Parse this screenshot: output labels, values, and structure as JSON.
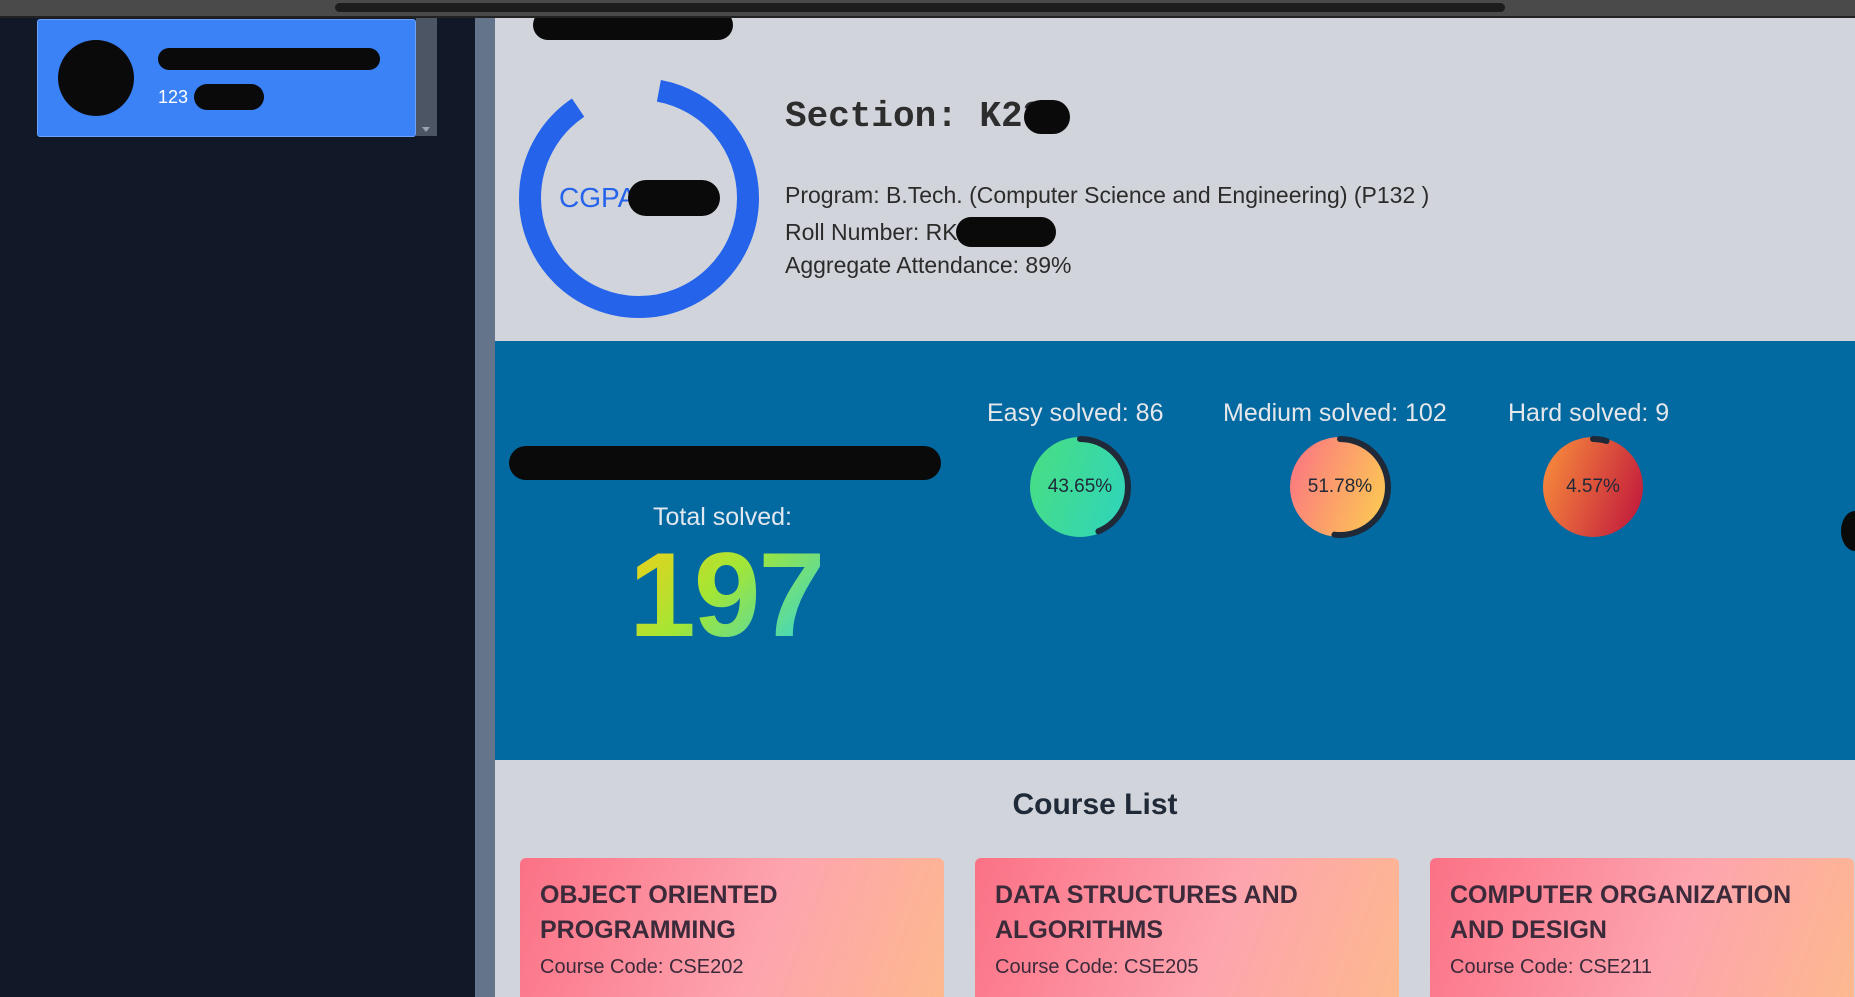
{
  "sidebar": {
    "user_id_prefix": "123"
  },
  "profile": {
    "cgpa_label": "CGPA",
    "section_text": "Section: K23",
    "program_text": "Program: B.Tech. (Computer Science and Engineering) (P132 )",
    "roll_text": "Roll Number: RK2",
    "attendance_text": "Aggregate Attendance: 89%"
  },
  "leetcode": {
    "total_label": "Total solved:",
    "total_value": "197",
    "categories": [
      {
        "label": "Easy solved: 86",
        "percent_text": "43.65%",
        "fraction": 0.4365,
        "gradient_from": "#4ade80",
        "gradient_to": "#2dd4bf"
      },
      {
        "label": "Medium solved: 102",
        "percent_text": "51.78%",
        "fraction": 0.5178,
        "gradient_from": "#fb7185",
        "gradient_to": "#fcd34d"
      },
      {
        "label": "Hard solved: 9",
        "percent_text": "4.57%",
        "fraction": 0.0457,
        "gradient_from": "#fb923c",
        "gradient_to": "#be123c"
      }
    ]
  },
  "courses": {
    "heading": "Course List",
    "items": [
      {
        "name": "OBJECT ORIENTED PROGRAMMING",
        "code": "Course Code: CSE202"
      },
      {
        "name": "DATA STRUCTURES AND ALGORITHMS",
        "code": "Course Code: CSE205"
      },
      {
        "name": "COMPUTER ORGANIZATION AND DESIGN",
        "code": "Course Code: CSE211"
      }
    ]
  },
  "colors": {
    "accent": "#2563eb",
    "stats_bg": "#0369a1",
    "sidebar_bg": "#111827"
  }
}
